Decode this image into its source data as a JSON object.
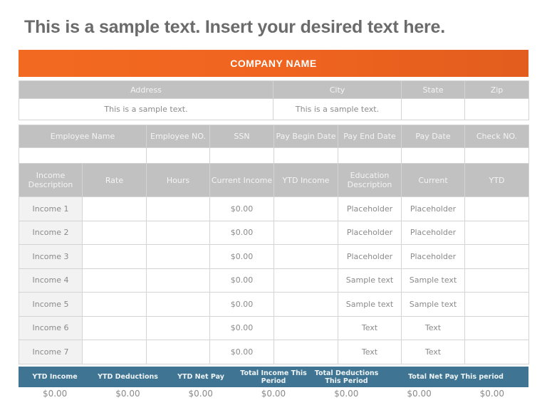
{
  "title": "This is a sample text. Insert your desired text here.",
  "company_name": "COMPANY NAME",
  "address_section": {
    "headers": [
      "Address",
      "City",
      "State",
      "Zip"
    ],
    "values": [
      "This is a sample text.",
      "This is a sample text.",
      "",
      ""
    ]
  },
  "employee_section": {
    "headers": [
      "Employee Name",
      "Employee NO.",
      "SSN",
      "Pay Begin Date",
      "Pay End Date",
      "Pay Date",
      "Check NO."
    ],
    "values": [
      "",
      "",
      "",
      "",
      "",
      "",
      ""
    ]
  },
  "income_section": {
    "headers": [
      "Income Description",
      "Rate",
      "Hours",
      "Current Income",
      "YTD Income",
      "Education Description",
      "Current",
      "YTD"
    ],
    "rows": [
      {
        "label": "Income 1",
        "rate": "",
        "hours": "",
        "current_income": "$0.00",
        "ytd_income": "",
        "education": "Placeholder",
        "current": "Placeholder",
        "ytd": ""
      },
      {
        "label": "Income 2",
        "rate": "",
        "hours": "",
        "current_income": "$0.00",
        "ytd_income": "",
        "education": "Placeholder",
        "current": "Placeholder",
        "ytd": ""
      },
      {
        "label": "Income 3",
        "rate": "",
        "hours": "",
        "current_income": "$0.00",
        "ytd_income": "",
        "education": "Placeholder",
        "current": "Placeholder",
        "ytd": ""
      },
      {
        "label": "Income 4",
        "rate": "",
        "hours": "",
        "current_income": "$0.00",
        "ytd_income": "",
        "education": "Sample text",
        "current": "Sample text",
        "ytd": ""
      },
      {
        "label": "Income 5",
        "rate": "",
        "hours": "",
        "current_income": "$0.00",
        "ytd_income": "",
        "education": "Sample text",
        "current": "Sample text",
        "ytd": ""
      },
      {
        "label": "Income 6",
        "rate": "",
        "hours": "",
        "current_income": "$0.00",
        "ytd_income": "",
        "education": "Text",
        "current": "Text",
        "ytd": ""
      },
      {
        "label": "Income 7",
        "rate": "",
        "hours": "",
        "current_income": "$0.00",
        "ytd_income": "",
        "education": "Text",
        "current": "Text",
        "ytd": ""
      }
    ]
  },
  "summary": {
    "headers": [
      "YTD Income",
      "YTD Deductions",
      "YTD Net Pay",
      "Total Income This Period",
      "Total Deductions This Period",
      "Total Net Pay This period"
    ],
    "values": [
      "$0.00",
      "$0.00",
      "$0.00",
      "$0.00",
      "$0.00",
      "$0.00",
      "$0.00"
    ]
  },
  "colors": {
    "accent_orange": "#f26a21",
    "header_gray": "#c1c1c1",
    "summary_blue": "#3f7592",
    "title_gray": "#6b6b6b"
  }
}
